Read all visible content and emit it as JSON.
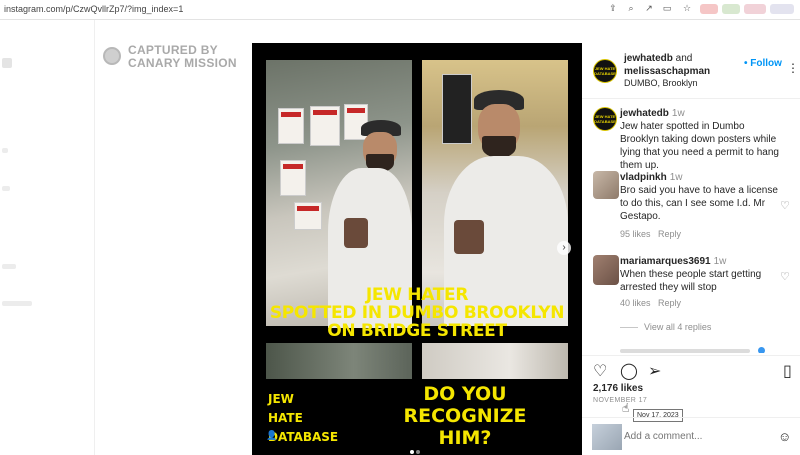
{
  "browser": {
    "url": "instagram.com/p/CzwQvllrZp7/?img_index=1"
  },
  "watermark": {
    "line1": "CAPTURED BY",
    "line2": "CANARY MISSION"
  },
  "post_image": {
    "headline_1": "JEW HATER",
    "headline_2": "SPOTTED IN DUMBO BROOKLYN",
    "headline_3": "ON BRIDGE STREET",
    "logo_1": "JEW",
    "logo_2": "HATE",
    "logo_3": "DATABASE",
    "cta_1": "DO YOU",
    "cta_2": "RECOGNIZE",
    "cta_3": "HIM?",
    "poster_word": "KIDNAPPED"
  },
  "header": {
    "user1": "jewhatedb",
    "and": " and",
    "user2": "melissaschapman",
    "location": "DUMBO, Brooklyn",
    "follow": "• Follow",
    "avatar_text": "JEW HATE DATABASE"
  },
  "comments": [
    {
      "user": "jewhatedb",
      "time": "1w",
      "text": "Jew hater spotted in Dumbo Brooklyn taking down posters while lying that you need a permit to hang them up."
    },
    {
      "user": "vladpinkh",
      "time": "1w",
      "text": "Bro said you have to have a license to do this, can I see some I.d. Mr Gestapo.",
      "likes": "95 likes",
      "reply": "Reply"
    },
    {
      "user": "mariamarques3691",
      "time": "1w",
      "text": "When these people start getting arrested they will stop",
      "likes": "40 likes",
      "reply": "Reply"
    }
  ],
  "view_replies": "View all 4 replies",
  "actions": {
    "likes": "2,176 likes",
    "date": "NOVEMBER 17",
    "tooltip": "Nov 17, 2023",
    "add_comment_placeholder": "Add a comment..."
  }
}
